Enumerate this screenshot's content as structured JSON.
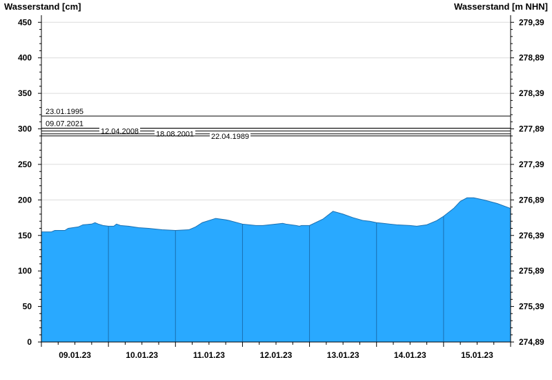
{
  "chart_data": {
    "type": "area",
    "ylabel_left": "Wasserstand [cm]",
    "ylabel_right": "Wasserstand [m NHN]",
    "ylim": [
      0,
      460
    ],
    "y_ticks_left": [
      0,
      50,
      100,
      150,
      200,
      250,
      300,
      350,
      400,
      450
    ],
    "y_ticks_right": [
      {
        "value": 0,
        "label": "274,89"
      },
      {
        "value": 50,
        "label": "275,39"
      },
      {
        "value": 100,
        "label": "275,89"
      },
      {
        "value": 150,
        "label": "276,39"
      },
      {
        "value": 200,
        "label": "276,89"
      },
      {
        "value": 250,
        "label": "277,39"
      },
      {
        "value": 300,
        "label": "277,89"
      },
      {
        "value": 350,
        "label": "278,39"
      },
      {
        "value": 400,
        "label": "278,89"
      },
      {
        "value": 450,
        "label": "279,39"
      }
    ],
    "x_range_days": [
      0,
      7
    ],
    "x_tick_labels": [
      "09.01.23",
      "10.01.23",
      "11.01.23",
      "12.01.23",
      "13.01.23",
      "14.01.23",
      "15.01.23"
    ],
    "grid": true,
    "fill_color": "#29a9ff",
    "edge_color": "#1a6fb0",
    "series": [
      {
        "x": [
          0.0,
          0.15,
          0.2,
          0.35,
          0.4,
          0.55,
          0.62,
          0.75,
          0.8,
          0.85,
          0.92,
          1.0,
          1.08,
          1.12,
          1.18,
          1.3,
          1.45,
          1.6,
          1.8,
          2.0,
          2.2,
          2.3,
          2.4,
          2.6,
          2.75,
          2.8,
          3.0,
          3.2,
          3.3,
          3.4,
          3.6,
          3.65,
          3.8,
          3.85,
          3.88,
          4.0,
          4.2,
          4.35,
          4.5,
          4.65,
          4.8,
          4.9,
          5.0,
          5.1,
          5.2,
          5.3,
          5.5,
          5.6,
          5.75,
          5.8,
          5.9,
          6.0,
          6.15,
          6.25,
          6.35,
          6.45,
          6.6,
          6.8,
          7.0
        ],
        "y": [
          155,
          155,
          157,
          157,
          160,
          162,
          165,
          166,
          168,
          166,
          164,
          163,
          163,
          166,
          164,
          163,
          161,
          160,
          158,
          157,
          158,
          162,
          168,
          174,
          172,
          171,
          166,
          164,
          164,
          165,
          167,
          166,
          164,
          163,
          164,
          164,
          173,
          184,
          180,
          175,
          171,
          170,
          168,
          167,
          166,
          165,
          164,
          163,
          165,
          167,
          171,
          177,
          188,
          198,
          203,
          203,
          200,
          195,
          188
        ]
      }
    ],
    "historic_levels": [
      {
        "label": "23.01.1995",
        "value": 318
      },
      {
        "label": "09.07.2021",
        "value": 301
      },
      {
        "label": "12.04.2008",
        "value": 297
      },
      {
        "label": "18.08.2001",
        "value": 293
      },
      {
        "label": "22.04.1989",
        "value": 290
      }
    ]
  }
}
